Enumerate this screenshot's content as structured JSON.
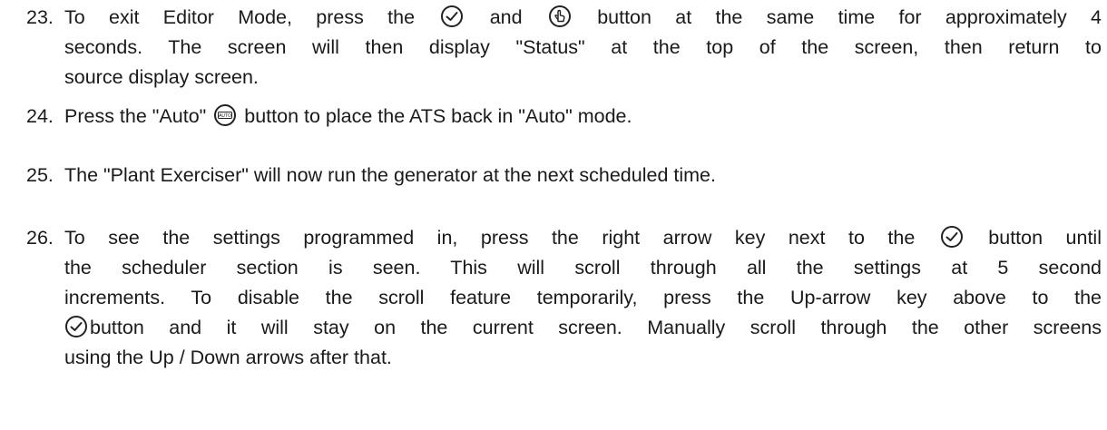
{
  "steps": [
    {
      "number": "23.",
      "line1_a": "To exit Editor Mode, press the",
      "line1_b": "and",
      "line1_c": "button at the same time for approximately 4",
      "line2": "seconds.  The screen will then display \"Status\" at the top of the screen, then return to",
      "line3": "source display screen."
    },
    {
      "number": "24.",
      "text_a": "Press the \"Auto\"",
      "text_b": "button to place the ATS back in \"Auto\" mode."
    },
    {
      "number": "25.",
      "text": "The \"Plant Exerciser\" will now run the generator at the next scheduled time."
    },
    {
      "number": "26.",
      "line1_a": "To see the settings programmed in, press the right arrow key next to the",
      "line1_b": "button until",
      "line2": "the scheduler section is seen.  This will scroll through all the settings at 5 second",
      "line3": "increments.  To disable the scroll feature temporarily, press the Up-arrow key above to the",
      "line4": "button and it will stay on the current screen.  Manually scroll through the other screens",
      "line5": "using the Up / Down arrows after that."
    }
  ],
  "icons": {
    "check": "check-circle-icon",
    "hand": "hand-pointer-circle-icon",
    "auto": "auto-button-icon",
    "auto_label": "AUTO"
  }
}
